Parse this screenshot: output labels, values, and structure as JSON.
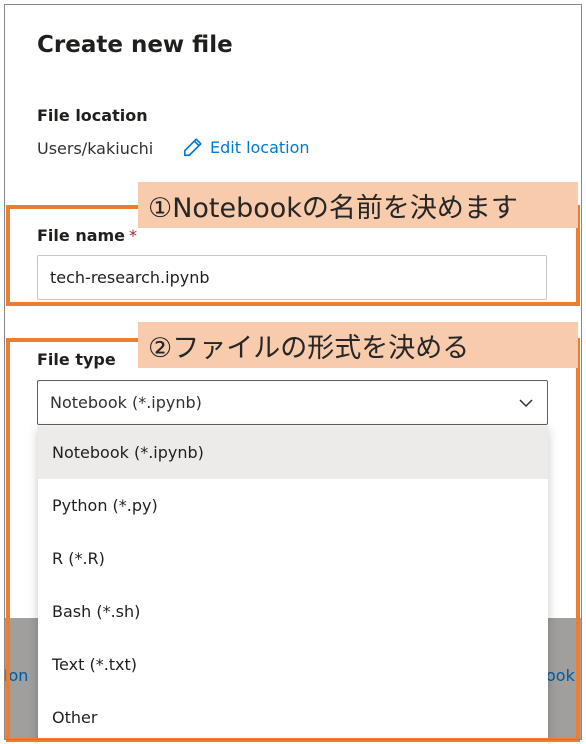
{
  "panel": {
    "title": "Create new file",
    "file_location_label": "File location",
    "location_path": "Users/kakiuchi",
    "edit_location_label": "Edit location",
    "file_name_label": "File name",
    "required_marker": "*",
    "file_name_value": "tech-research.ipynb",
    "file_type_label": "File type",
    "file_type_selected": "Notebook (*.ipynb)"
  },
  "dropdown": {
    "options": [
      "Notebook (*.ipynb)",
      "Python (*.py)",
      "R (*.R)",
      "Bash (*.sh)",
      "Text (*.txt)",
      "Other"
    ],
    "selected_index": 0
  },
  "background": {
    "left_fragment": "lon",
    "right_fragment": "ook"
  },
  "annotations": {
    "callout_1": "①Notebookの名前を決めます",
    "callout_2": "②ファイルの形式を決める"
  },
  "colors": {
    "accent": "#0078d4",
    "highlight_border": "#ed7d31",
    "callout_fill": "#f8cbad",
    "required": "#a4262c"
  },
  "icons": {
    "edit": "pencil-icon",
    "dropdown": "chevron-down-icon"
  }
}
